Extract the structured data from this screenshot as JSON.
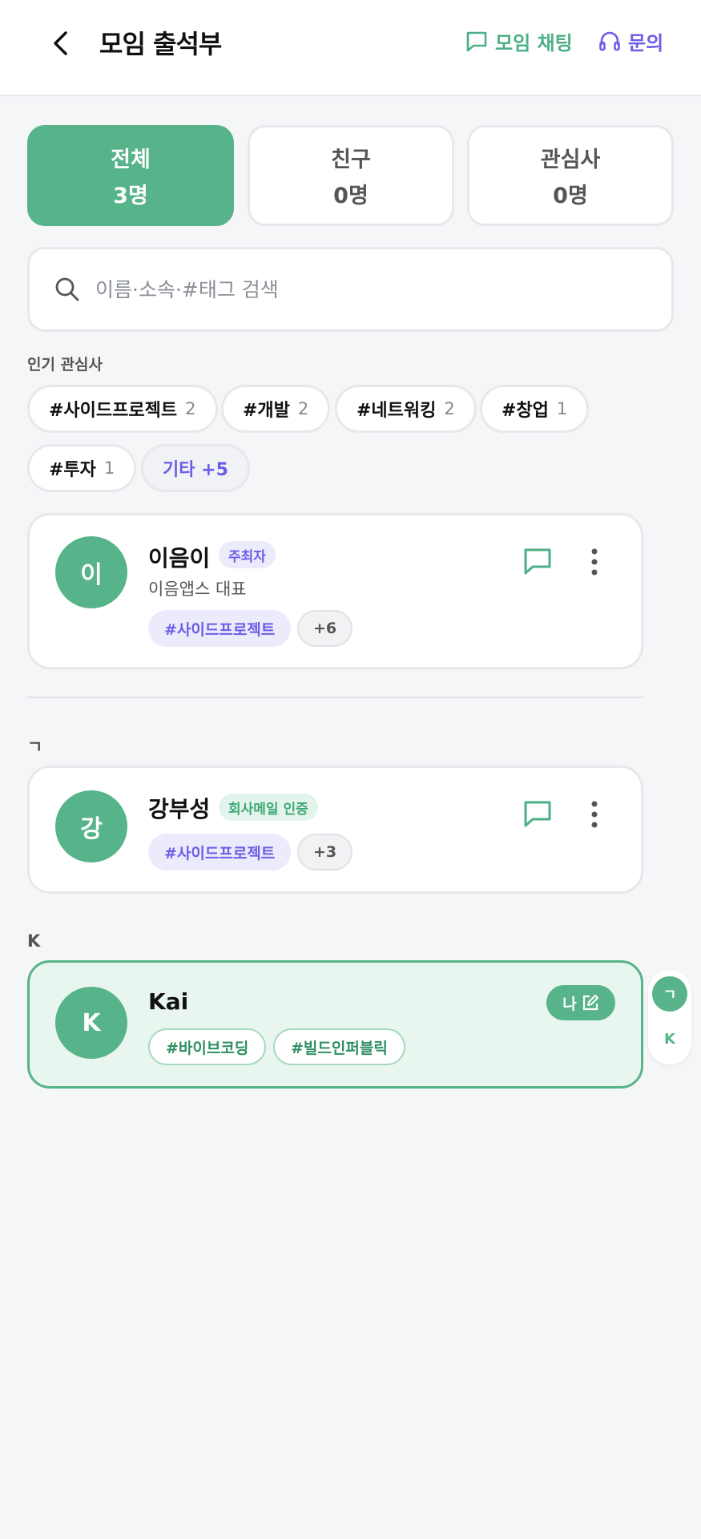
{
  "header": {
    "title": "모임 출석부",
    "chat_label": "모임 채팅",
    "inquiry_label": "문의"
  },
  "tabs": [
    {
      "label": "전체",
      "count": "3명",
      "active": true
    },
    {
      "label": "친구",
      "count": "0명",
      "active": false
    },
    {
      "label": "관심사",
      "count": "0명",
      "active": false
    }
  ],
  "search": {
    "placeholder": "이름·소속·#태그 검색",
    "value": ""
  },
  "popular": {
    "label": "인기 관심사",
    "chips": [
      {
        "tag": "#사이드프로젝트",
        "count": "2"
      },
      {
        "tag": "#개발",
        "count": "2"
      },
      {
        "tag": "#네트워킹",
        "count": "2"
      },
      {
        "tag": "#창업",
        "count": "1"
      },
      {
        "tag": "#투자",
        "count": "1"
      }
    ],
    "more_label": "기타 +5"
  },
  "members": {
    "pinned": {
      "avatar": "이",
      "name": "이음이",
      "badge": "주최자",
      "subtitle": "이음앱스 대표",
      "tag": "#사이드프로젝트",
      "more": "+6"
    },
    "groups": [
      {
        "index": "ㄱ",
        "member": {
          "avatar": "강",
          "name": "강부성",
          "badge": "회사메일 인증",
          "tag": "#사이드프로젝트",
          "more": "+3"
        }
      },
      {
        "index": "K",
        "member": {
          "avatar": "K",
          "name": "Kai",
          "me_label": "나",
          "tags": [
            "#바이브코딩",
            "#빌드인퍼블릭"
          ]
        }
      }
    ]
  },
  "index_rail": [
    "ㄱ",
    "K"
  ],
  "colors": {
    "accent_green": "#57b389",
    "accent_purple": "#6c5ce7",
    "background": "#f5f6f8"
  }
}
